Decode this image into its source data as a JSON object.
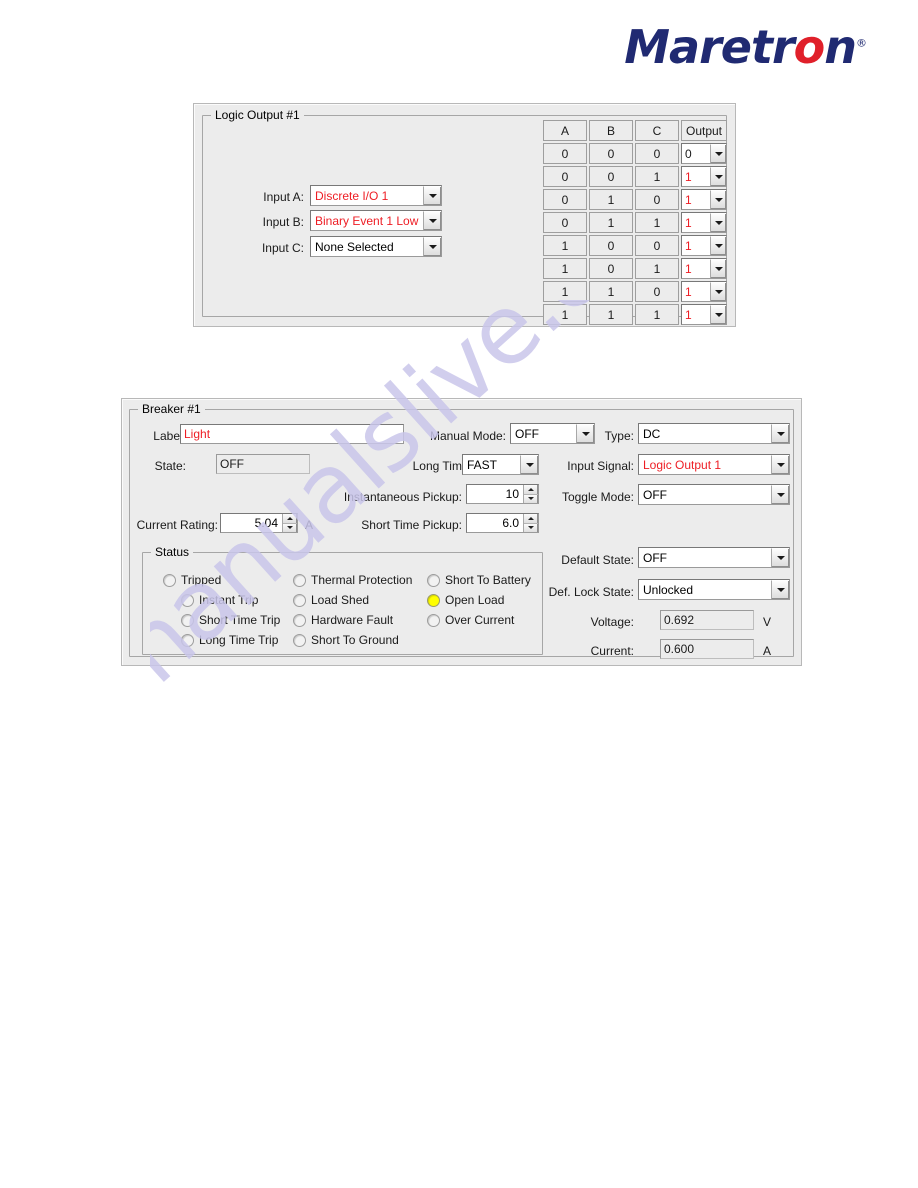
{
  "brand": {
    "name_part1": "Maretr",
    "name_red_o": "o",
    "name_part2": "n",
    "registered": "®",
    "blue": "#202a72",
    "red": "#e0202a"
  },
  "watermark": {
    "text": "manualslive.com",
    "color": "#c9c6ea"
  },
  "logic_output_panel": {
    "title": "Logic Output #1",
    "inputs": [
      {
        "label": "Input A:",
        "value": "Discrete I/O 1",
        "red": true
      },
      {
        "label": "Input B:",
        "value": "Binary Event 1 Low",
        "red": true
      },
      {
        "label": "Input C:",
        "value": "None Selected",
        "red": false
      }
    ],
    "truth_table": {
      "headers": [
        "A",
        "B",
        "C",
        "Output"
      ],
      "rows": [
        {
          "a": "0",
          "b": "0",
          "c": "0",
          "output": "0",
          "output_red": false
        },
        {
          "a": "0",
          "b": "0",
          "c": "1",
          "output": "1",
          "output_red": true
        },
        {
          "a": "0",
          "b": "1",
          "c": "0",
          "output": "1",
          "output_red": true
        },
        {
          "a": "0",
          "b": "1",
          "c": "1",
          "output": "1",
          "output_red": true
        },
        {
          "a": "1",
          "b": "0",
          "c": "0",
          "output": "1",
          "output_red": true
        },
        {
          "a": "1",
          "b": "0",
          "c": "1",
          "output": "1",
          "output_red": true
        },
        {
          "a": "1",
          "b": "1",
          "c": "0",
          "output": "1",
          "output_red": true
        },
        {
          "a": "1",
          "b": "1",
          "c": "1",
          "output": "1",
          "output_red": true
        }
      ]
    }
  },
  "breaker_panel": {
    "title": "Breaker #1",
    "label_field": {
      "label": "Label:",
      "value": "Light"
    },
    "state_field": {
      "label": "State:",
      "value": "OFF"
    },
    "current_rating": {
      "label": "Current Rating:",
      "value": "5.04",
      "unit": "A"
    },
    "manual_mode": {
      "label": "Manual Mode:",
      "value": "OFF"
    },
    "long_time_delay": {
      "label": "Long Time Delay:",
      "value": "FAST"
    },
    "instantaneous_pickup": {
      "label": "Instantaneous Pickup:",
      "value": "10"
    },
    "short_time_pickup": {
      "label": "Short Time Pickup:",
      "value": "6.0"
    },
    "type": {
      "label": "Type:",
      "value": "DC"
    },
    "input_signal": {
      "label": "Input Signal:",
      "value": "Logic Output 1"
    },
    "toggle_mode": {
      "label": "Toggle Mode:",
      "value": "OFF"
    },
    "default_state": {
      "label": "Default State:",
      "value": "OFF"
    },
    "def_lock_state": {
      "label": "Def. Lock State:",
      "value": "Unlocked"
    },
    "voltage": {
      "label": "Voltage:",
      "value": "0.692",
      "unit": "V"
    },
    "current": {
      "label": "Current:",
      "value": "0.600",
      "unit": "A"
    },
    "status": {
      "title": "Status",
      "led_on_color": "#ffff00",
      "column1": [
        {
          "label": "Tripped",
          "on": false
        },
        {
          "label": "Instant Trip",
          "on": false
        },
        {
          "label": "Short Time Trip",
          "on": false
        },
        {
          "label": "Long Time Trip",
          "on": false
        }
      ],
      "column2": [
        {
          "label": "Thermal Protection",
          "on": false
        },
        {
          "label": "Load Shed",
          "on": false
        },
        {
          "label": "Hardware Fault",
          "on": false
        },
        {
          "label": "Short To Ground",
          "on": false
        }
      ],
      "column3": [
        {
          "label": "Short To Battery",
          "on": false
        },
        {
          "label": "Open Load",
          "on": true
        },
        {
          "label": "Over Current",
          "on": false
        }
      ]
    }
  }
}
